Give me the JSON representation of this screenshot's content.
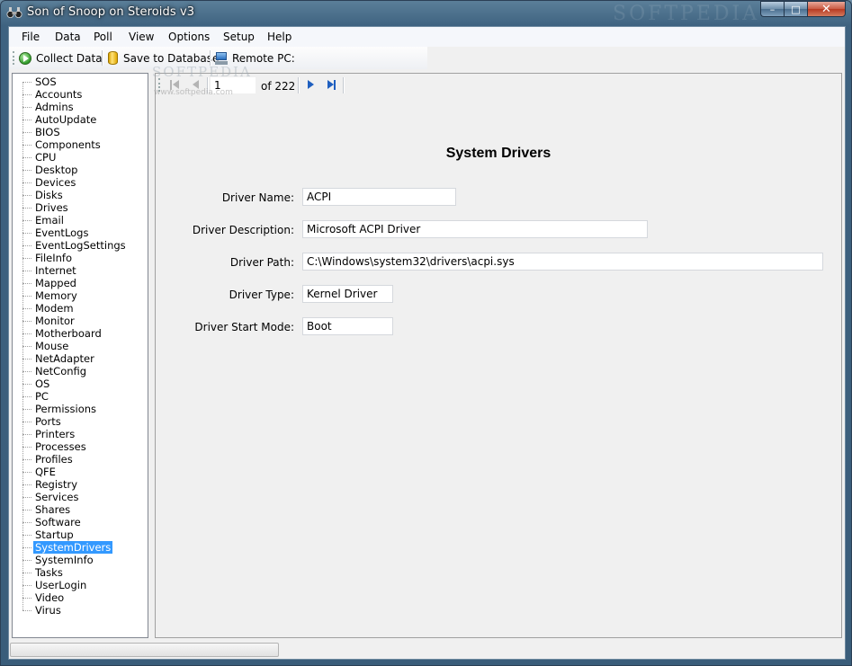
{
  "window": {
    "title": "Son of Snoop on Steroids v3",
    "watermark": "SOFTPEDIA",
    "controls": {
      "minimize": "–",
      "maximize": "□",
      "close": "✕"
    }
  },
  "menu": [
    "File",
    "Data",
    "Poll",
    "View",
    "Options",
    "Setup",
    "Help"
  ],
  "toolbar": {
    "collect_label": "Collect Data",
    "save_label": "Save to Database",
    "remote_label": "Remote PC:",
    "remote_value": ""
  },
  "watermark_overlay": {
    "logo": "SOFTPEDIA",
    "url": "www.softpedia.com"
  },
  "tree": {
    "items": [
      "SOS",
      "Accounts",
      "Admins",
      "AutoUpdate",
      "BIOS",
      "Components",
      "CPU",
      "Desktop",
      "Devices",
      "Disks",
      "Drives",
      "Email",
      "EventLogs",
      "EventLogSettings",
      "FileInfo",
      "Internet",
      "Mapped",
      "Memory",
      "Modem",
      "Monitor",
      "Motherboard",
      "Mouse",
      "NetAdapter",
      "NetConfig",
      "OS",
      "PC",
      "Permissions",
      "Ports",
      "Printers",
      "Processes",
      "Profiles",
      "QFE",
      "Registry",
      "Services",
      "Shares",
      "Software",
      "Startup",
      "SystemDrivers",
      "SystemInfo",
      "Tasks",
      "UserLogin",
      "Video",
      "Virus"
    ],
    "selected": "SystemDrivers"
  },
  "navigator": {
    "position": "1",
    "count_text": "of 222"
  },
  "details": {
    "heading": "System Drivers",
    "fields": [
      {
        "label": "Driver Name:",
        "value": "ACPI"
      },
      {
        "label": "Driver Description:",
        "value": "Microsoft ACPI Driver"
      },
      {
        "label": "Driver Path:",
        "value": "C:\\Windows\\system32\\drivers\\acpi.sys"
      },
      {
        "label": "Driver Type:",
        "value": "Kernel Driver"
      },
      {
        "label": "Driver Start Mode:",
        "value": "Boot"
      }
    ]
  },
  "status": {
    "progress": 0
  },
  "colors": {
    "selection": "#3399ff",
    "nav_enabled": "#1f5fbf",
    "title_bar": "#3e6280"
  }
}
